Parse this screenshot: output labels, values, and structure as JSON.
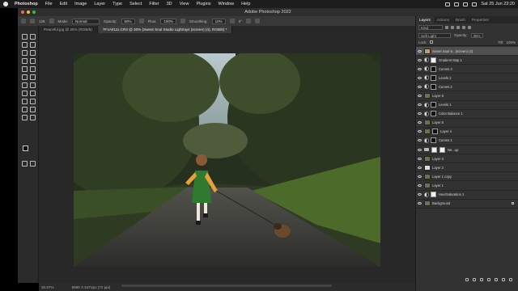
{
  "menubar": {
    "app_name": "Photoshop",
    "items": [
      "File",
      "Edit",
      "Image",
      "Layer",
      "Type",
      "Select",
      "Filter",
      "3D",
      "View",
      "Plugins",
      "Window",
      "Help"
    ],
    "clock": "Sat 25 Jun  23:20"
  },
  "window": {
    "title": "Adobe Photoshop 2022"
  },
  "options_bar": {
    "brush_size": "125",
    "mode_label": "Mode:",
    "mode_value": "Normal",
    "opacity_label": "Opacity:",
    "opacity_value": "60%",
    "flow_label": "Flow:",
    "flow_value": "100%",
    "smoothing_label": "Smoothing:",
    "smoothing_value": "10%",
    "angle_value": "0°",
    "share_label": "Share"
  },
  "document_tabs": [
    {
      "label": "Peaceful.jpg @ 25% (RGB/8)"
    },
    {
      "label": "7F1A0111.CR3 @ 30% (Sweet Soul Studio Lightrays (screen) (4), RGB/8) *"
    }
  ],
  "status_bar": {
    "zoom": "30.87%",
    "doc_info": "6960 X 5374px (72 ppi)"
  },
  "layers_panel": {
    "tabs": [
      "Layers",
      "Actions",
      "Brush",
      "Properties"
    ],
    "filter_label": "Kind",
    "blend_mode": "Soft Light",
    "opacity_label": "Opacity:",
    "opacity_value": "35%",
    "lock_label": "Lock:",
    "fill_label": "Fill:",
    "fill_value": "100%",
    "layers": [
      {
        "name": "Sweet Soul S...(screen) (4)",
        "kind": "pixel",
        "selected": true
      },
      {
        "name": "Gradient Map 1",
        "kind": "adjustment"
      },
      {
        "name": "Curves 3",
        "kind": "adjustment"
      },
      {
        "name": "Levels 2",
        "kind": "adjustment"
      },
      {
        "name": "Curves 2",
        "kind": "adjustment"
      },
      {
        "name": "Layer 8",
        "kind": "pixel"
      },
      {
        "name": "Levels 1",
        "kind": "adjustment"
      },
      {
        "name": "Color Balance 1",
        "kind": "adjustment"
      },
      {
        "name": "Layer 6",
        "kind": "pixel"
      },
      {
        "name": "Layer 4",
        "kind": "pixel"
      },
      {
        "name": "Curves 1",
        "kind": "adjustment"
      },
      {
        "name": "Ne...up",
        "kind": "group"
      },
      {
        "name": "Layer 3",
        "kind": "pixel"
      },
      {
        "name": "Layer 2",
        "kind": "pixel"
      },
      {
        "name": "Layer 1 copy",
        "kind": "pixel"
      },
      {
        "name": "Layer 1",
        "kind": "pixel"
      },
      {
        "name": "Hue/Saturation 1",
        "kind": "adjustment"
      },
      {
        "name": "Background",
        "kind": "pixel"
      }
    ]
  }
}
